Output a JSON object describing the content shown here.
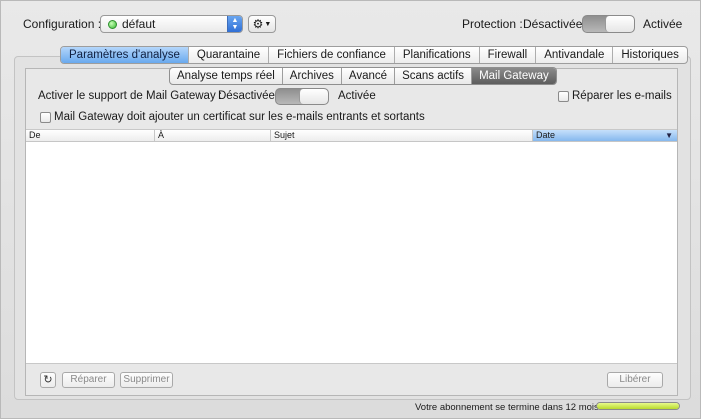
{
  "top": {
    "config_label": "Configuration :",
    "config_value": "défaut",
    "protection_label": "Protection :",
    "protection_off": "Désactivée",
    "protection_on": "Activée"
  },
  "main_tabs": [
    {
      "label": "Paramètres d'analyse",
      "active": true
    },
    {
      "label": "Quarantaine",
      "active": false
    },
    {
      "label": "Fichiers de confiance",
      "active": false
    },
    {
      "label": "Planifications",
      "active": false
    },
    {
      "label": "Firewall",
      "active": false
    },
    {
      "label": "Antivandale",
      "active": false
    },
    {
      "label": "Historiques",
      "active": false
    }
  ],
  "sub_tabs": [
    {
      "label": "Analyse temps réel",
      "active": false
    },
    {
      "label": "Archives",
      "active": false
    },
    {
      "label": "Avancé",
      "active": false
    },
    {
      "label": "Scans actifs",
      "active": false
    },
    {
      "label": "Mail Gateway",
      "active": true
    }
  ],
  "mail_gateway": {
    "support_label": "Activer le support de Mail Gateway :",
    "off_label": "Désactivée",
    "on_label": "Activée",
    "repair_label": "Réparer les e-mails",
    "cert_label": "Mail Gateway doit ajouter un certificat sur les e-mails entrants et sortants"
  },
  "table": {
    "columns": [
      "De",
      "À",
      "Sujet",
      "Date"
    ],
    "rows": []
  },
  "buttons": {
    "repair": "Réparer",
    "delete": "Supprimer",
    "free": "Libérer"
  },
  "footer": {
    "subscription_text": "Votre abonnement se termine dans 12 mois",
    "subscription_progress": 1.0
  },
  "colors": {
    "tab_active": "#69a9ee",
    "subtab_active": "#5d5d5d",
    "status_dot": "#37b82f",
    "progress_fill": "#c8e640"
  }
}
